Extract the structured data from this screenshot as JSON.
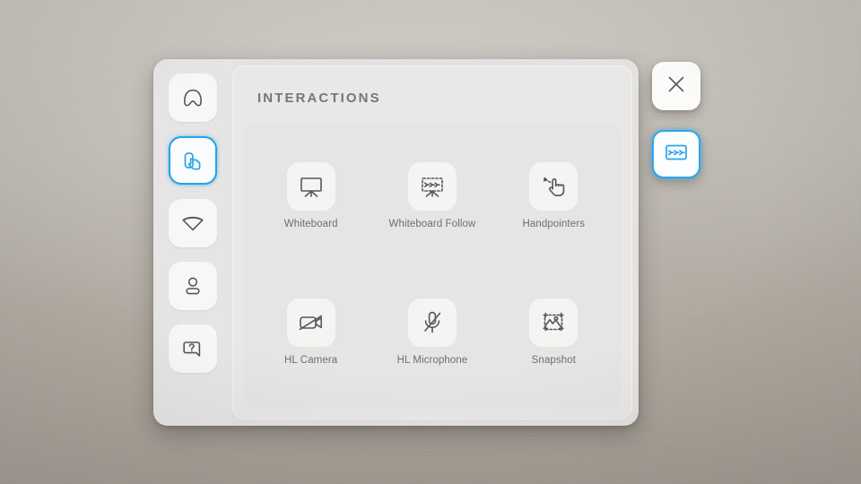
{
  "window": {
    "panel_title": "INTERACTIONS"
  },
  "colors": {
    "accent": "#29a6ea",
    "panel_bg": "#e9e8e6",
    "sidebar_bg": "#e6e5e3",
    "tile_bg": "#f5f4f3",
    "label_text": "#6e6e72",
    "title_text": "#76767a",
    "icon_stroke": "#57575a",
    "wall_bg": "#b0aaa1"
  },
  "sidebar": {
    "items": [
      {
        "icon": "arch-home-icon",
        "label": "Home",
        "active": false
      },
      {
        "icon": "hand-touch-panel-icon",
        "label": "Interactions",
        "active": true
      },
      {
        "icon": "wifi-cone-icon",
        "label": "Network",
        "active": false
      },
      {
        "icon": "person-icon",
        "label": "Profile",
        "active": false
      },
      {
        "icon": "help-bubble-icon",
        "label": "Help",
        "active": false
      }
    ]
  },
  "main": {
    "tiles": [
      {
        "icon": "whiteboard-icon",
        "label": "Whiteboard"
      },
      {
        "icon": "whiteboard-follow-icon",
        "label": "Whiteboard Follow"
      },
      {
        "icon": "handpointers-icon",
        "label": "Handpointers"
      },
      {
        "icon": "camera-off-icon",
        "label": "HL Camera"
      },
      {
        "icon": "microphone-off-icon",
        "label": "HL Microphone"
      },
      {
        "icon": "snapshot-icon",
        "label": "Snapshot"
      }
    ]
  },
  "side_buttons": [
    {
      "icon": "close-icon",
      "label": "Close",
      "active": false
    },
    {
      "icon": "whiteboard-follow-toggle-icon",
      "label": "Whiteboard Follow",
      "active": true
    }
  ]
}
